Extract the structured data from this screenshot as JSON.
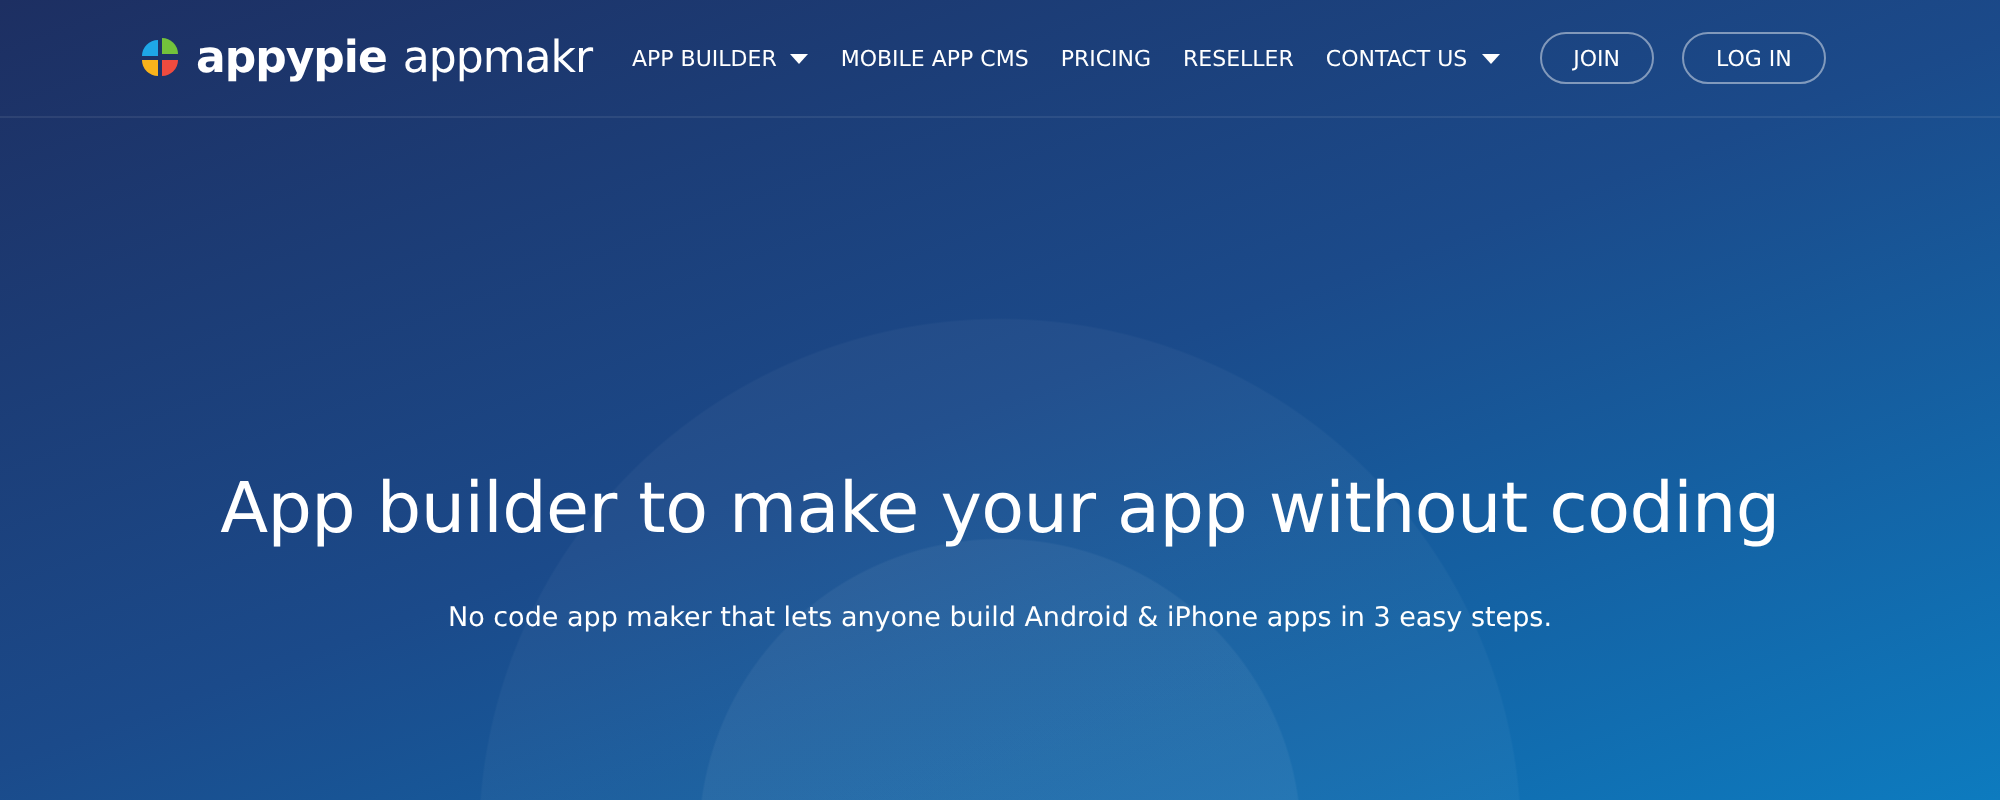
{
  "header": {
    "logo": {
      "brand": "appypie",
      "product": "appmakr"
    },
    "nav": [
      {
        "label": "APP BUILDER",
        "has_menu": true
      },
      {
        "label": "MOBILE APP CMS",
        "has_menu": false
      },
      {
        "label": "PRICING",
        "has_menu": false
      },
      {
        "label": "RESELLER",
        "has_menu": false
      },
      {
        "label": "CONTACT US",
        "has_menu": true
      }
    ],
    "buttons": [
      "JOIN",
      "LOG IN"
    ]
  },
  "hero": {
    "title": "App builder to make your app without coding",
    "subtitle": "No code app maker that lets anyone build Android & iPhone apps in 3 easy steps."
  }
}
